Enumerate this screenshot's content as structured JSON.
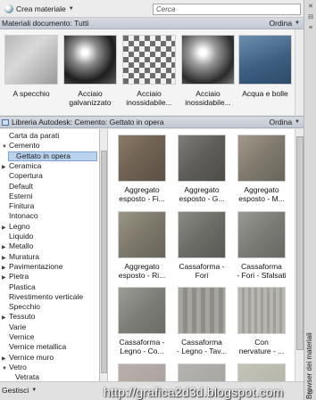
{
  "toolbar": {
    "create_label": "Crea materiale",
    "search_placeholder": "Cerca"
  },
  "doc_panel": {
    "title": "Materiali documento: Tutti",
    "sort_label": "Ordina",
    "items": [
      {
        "label": "A specchio"
      },
      {
        "label": "Acciaio\ngalvanizzato"
      },
      {
        "label": "Acciaio\ninossidabile..."
      },
      {
        "label": "Acciaio\ninossidabile..."
      },
      {
        "label": "Acqua e bolle"
      }
    ]
  },
  "library_panel": {
    "title": "Libreria Autodesk: Cemento: Gettato in opera",
    "sort_label": "Ordina",
    "tree": [
      {
        "label": "Carta da parati",
        "arrow": ""
      },
      {
        "label": "Cemento",
        "arrow": "▼"
      },
      {
        "label": "Gettato in opera",
        "arrow": "",
        "selected": true
      },
      {
        "label": "Ceramica",
        "arrow": "▶"
      },
      {
        "label": "Copertura",
        "arrow": ""
      },
      {
        "label": "Default",
        "arrow": ""
      },
      {
        "label": "Esterni",
        "arrow": ""
      },
      {
        "label": "Finitura",
        "arrow": ""
      },
      {
        "label": "Intonaco",
        "arrow": ""
      },
      {
        "label": "Legno",
        "arrow": "▶"
      },
      {
        "label": "Liquido",
        "arrow": ""
      },
      {
        "label": "Metallo",
        "arrow": "▶"
      },
      {
        "label": "Muratura",
        "arrow": "▶"
      },
      {
        "label": "Pavimentazione",
        "arrow": "▶"
      },
      {
        "label": "Pietra",
        "arrow": "▶"
      },
      {
        "label": "Plastica",
        "arrow": ""
      },
      {
        "label": "Rivestimento verticale",
        "arrow": ""
      },
      {
        "label": "Specchio",
        "arrow": ""
      },
      {
        "label": "Tessuto",
        "arrow": "▶"
      },
      {
        "label": "Varie",
        "arrow": ""
      },
      {
        "label": "Vernice",
        "arrow": ""
      },
      {
        "label": "Vernice metallica",
        "arrow": ""
      },
      {
        "label": "Vernice muro",
        "arrow": "▶"
      },
      {
        "label": "Vetro",
        "arrow": "▼"
      },
      {
        "label": "Vetrata",
        "arrow": ""
      }
    ],
    "materials": [
      {
        "label": "Aggregato\nesposto - Fi..."
      },
      {
        "label": "Aggregato\nesposto - G..."
      },
      {
        "label": "Aggregato\nesposto - M..."
      },
      {
        "label": "Aggregato\nesposto - Ri..."
      },
      {
        "label": "Cassaforma -\nFori"
      },
      {
        "label": "Cassaforma\n- Fori - Sfalsati"
      },
      {
        "label": "Cassaforma -\nLegno - Co..."
      },
      {
        "label": "Cassaforma\n- Legno - Tav..."
      },
      {
        "label": "Con\nnervature - ..."
      },
      {
        "label": ""
      },
      {
        "label": ""
      },
      {
        "label": ""
      }
    ]
  },
  "sidebar": {
    "title": "Browser dei materiali"
  },
  "bottom": {
    "manage_label": "Gestisci"
  },
  "watermark": "http://grafica2d3d.blogspot.com"
}
